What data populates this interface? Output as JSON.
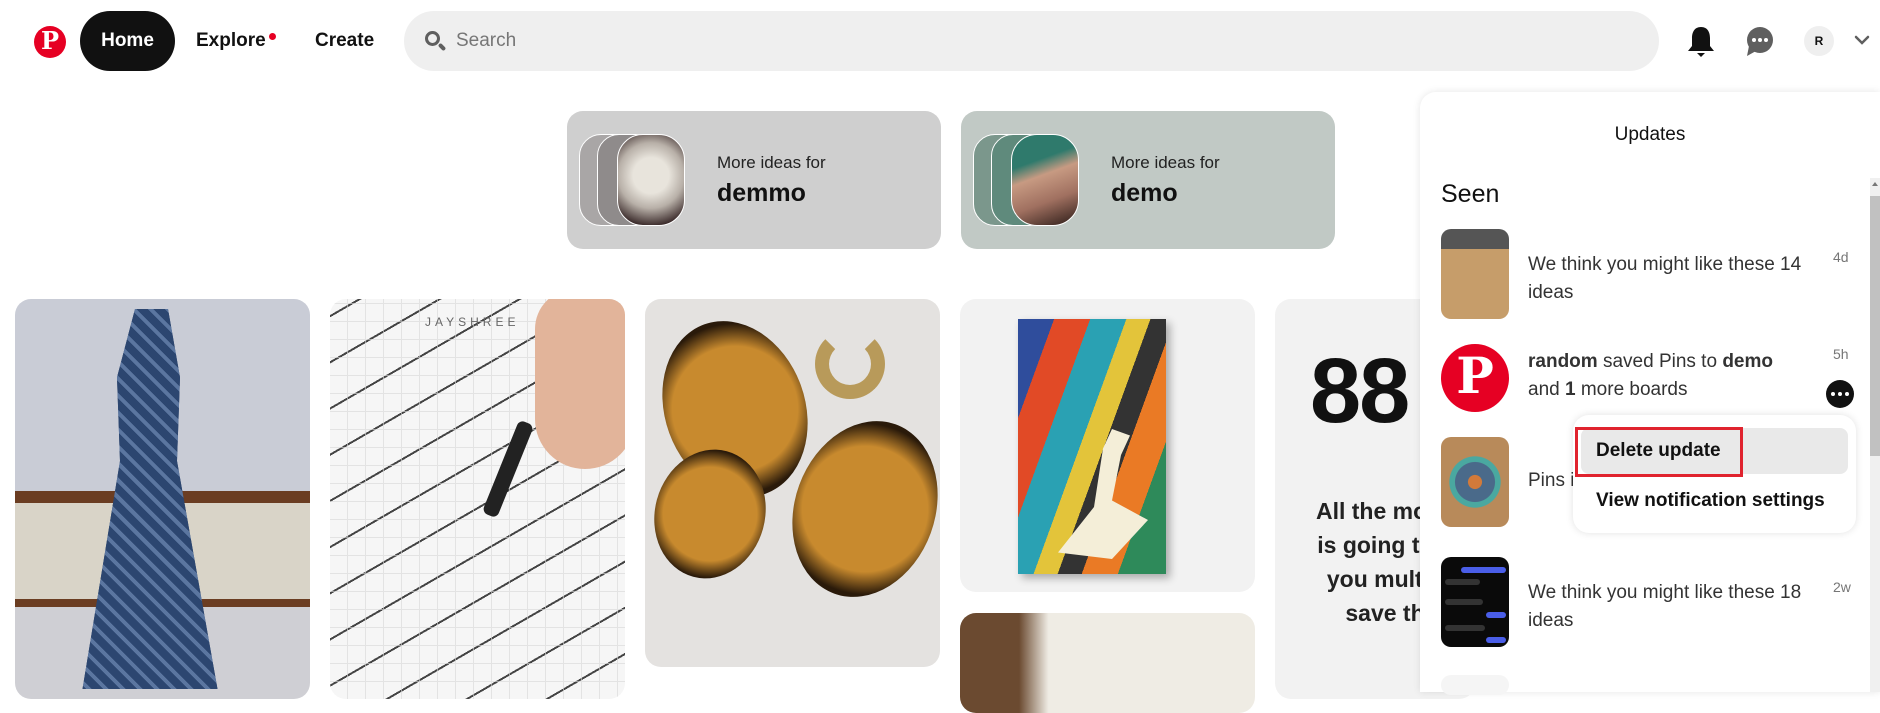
{
  "header": {
    "logo_letter": "P",
    "nav": {
      "home_label": "Home",
      "explore_label": "Explore",
      "create_label": "Create"
    },
    "search": {
      "placeholder": "Search",
      "value": ""
    },
    "avatar_initial": "R",
    "icons": [
      "pinterest-logo-icon",
      "search-icon",
      "bell-icon",
      "chat-icon",
      "chevron-down-icon"
    ]
  },
  "idea_cards": [
    {
      "subtitle": "More ideas for",
      "title": "demmo"
    },
    {
      "subtitle": "More ideas for",
      "title": "demo"
    }
  ],
  "pins": {
    "notebook_watermark": "JAYSHREE",
    "text_pin": {
      "number": "88",
      "lines": [
        "All the mone",
        "is going to c",
        "you multip",
        "save th"
      ]
    }
  },
  "updates_panel": {
    "title": "Updates",
    "section_heading": "Seen",
    "notifications": [
      {
        "text": "We think you might like these 14 ideas",
        "time": "4d"
      },
      {
        "user": "random",
        "action": " saved Pins to ",
        "board": "demo",
        "line2_prefix": "and ",
        "count": "1",
        "line2_suffix": " more boards",
        "time": "5h"
      },
      {
        "text": "Pins in"
      },
      {
        "text": "We think you might like these 18 ideas",
        "time": "2w"
      }
    ]
  },
  "context_menu": {
    "items": [
      {
        "label": "Delete update",
        "highlighted": true
      },
      {
        "label": "View notification settings",
        "highlighted": false
      }
    ]
  },
  "colors": {
    "brand_red": "#e60023",
    "highlight_border": "#e0232e",
    "nav_active_bg": "#111111"
  }
}
